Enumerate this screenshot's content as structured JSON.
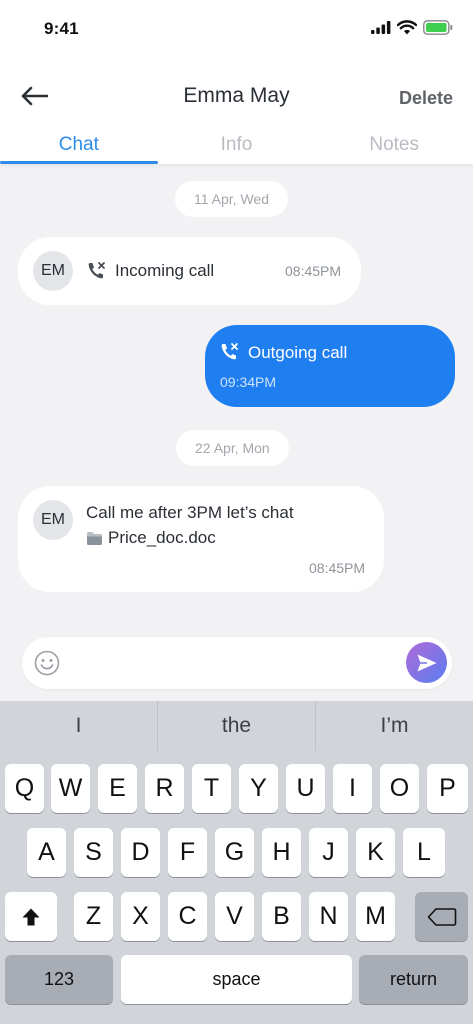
{
  "status_bar": {
    "time": "9:41"
  },
  "header": {
    "title": "Emma May",
    "delete_label": "Delete",
    "tabs": [
      {
        "label": "Chat",
        "active": true
      },
      {
        "label": "Info",
        "active": false
      },
      {
        "label": "Notes",
        "active": false
      }
    ]
  },
  "messages": {
    "date1": "11 Apr, Wed",
    "incoming_call": {
      "avatar": "EM",
      "text": "Incoming call",
      "time": "08:45PM"
    },
    "outgoing_call": {
      "text": "Outgoing call",
      "time": "09:34PM"
    },
    "date2": "22 Apr, Mon",
    "text_message": {
      "avatar": "EM",
      "text": "Call me after 3PM let’s chat",
      "attachment": "Price_doc.doc",
      "time": "08:45PM"
    }
  },
  "composer": {
    "value": "",
    "placeholder": ""
  },
  "keyboard": {
    "suggestions": [
      "I",
      "the",
      "I’m"
    ],
    "row1": [
      "Q",
      "W",
      "E",
      "R",
      "T",
      "Y",
      "U",
      "I",
      "O",
      "P"
    ],
    "row2": [
      "A",
      "S",
      "D",
      "F",
      "G",
      "H",
      "J",
      "K",
      "L"
    ],
    "row3": [
      "Z",
      "X",
      "C",
      "V",
      "B",
      "N",
      "M"
    ],
    "numbers_label": "123",
    "space_label": "space",
    "return_label": "return"
  },
  "colors": {
    "accent": "#2f8be8",
    "outgoing_bubble": "#1f7ff0",
    "background": "#f2f2f4"
  }
}
